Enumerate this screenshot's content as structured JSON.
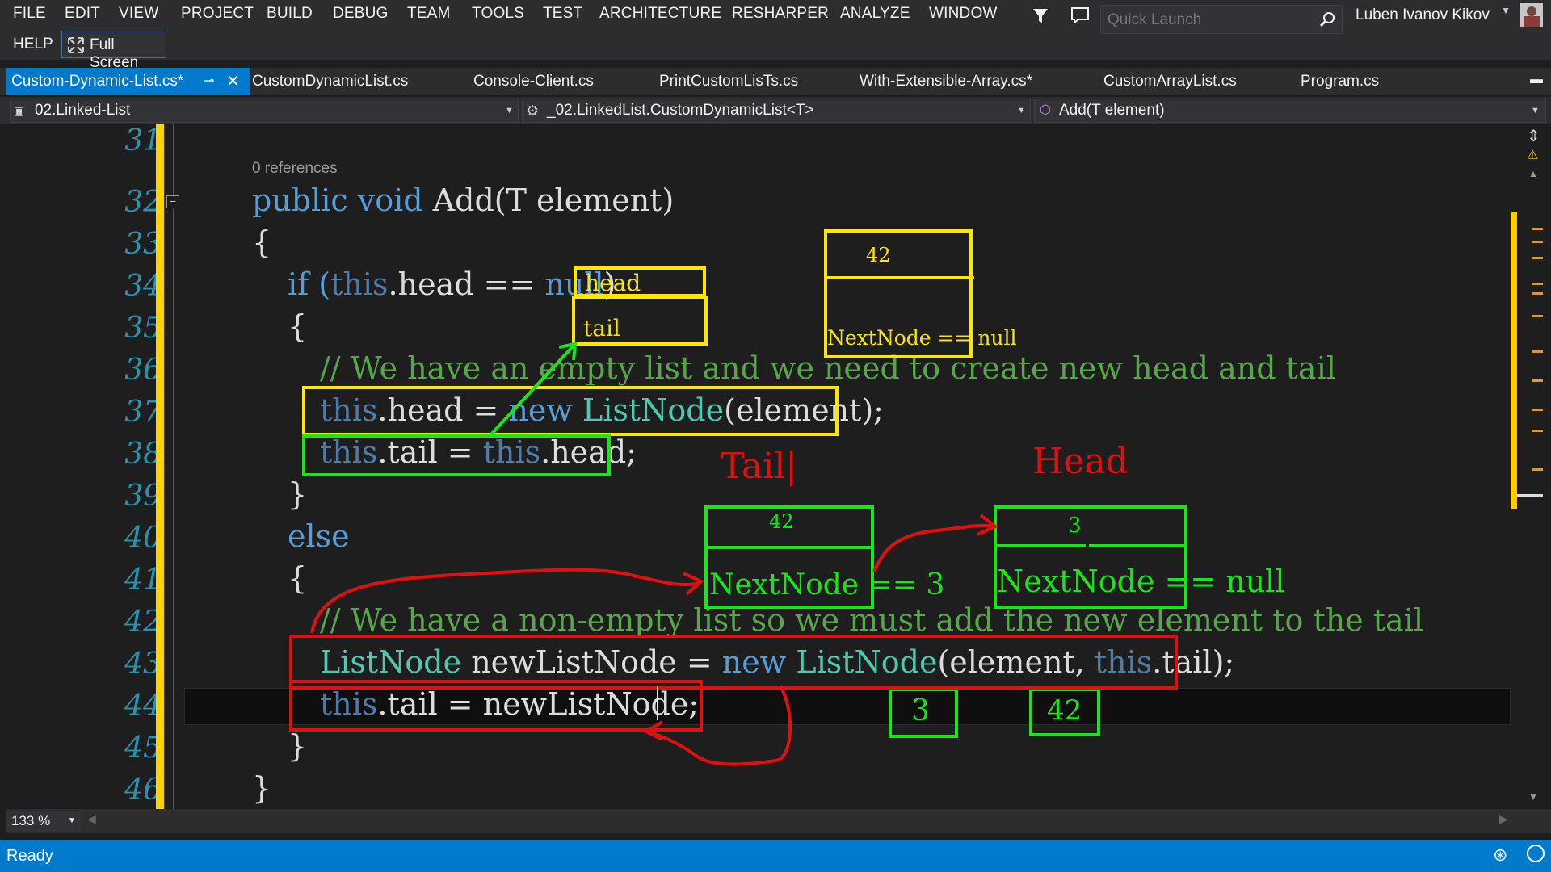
{
  "menu": {
    "items": [
      "FILE",
      "EDIT",
      "VIEW",
      "PROJECT",
      "BUILD",
      "DEBUG",
      "TEAM",
      "TOOLS",
      "TEST",
      "ARCHITECTURE",
      "RESHARPER",
      "ANALYZE",
      "WINDOW"
    ],
    "help": "HELP",
    "full_screen": "Full Screen",
    "quick_launch_placeholder": "Quick Launch",
    "user": "Luben Ivanov Kikov"
  },
  "tabs": [
    "Custom-Dynamic-List.cs*",
    "CustomDynamicList.cs",
    "Console-Client.cs",
    "PrintCustomLisTs.cs",
    "With-Extensible-Array.cs*",
    "CustomArrayList.cs",
    "Program.cs"
  ],
  "nav": {
    "project": "02.Linked-List",
    "class": "_02.LinkedList.CustomDynamicList<T>",
    "member": "Add(T element)"
  },
  "editor": {
    "line_numbers": [
      "31",
      "32",
      "33",
      "34",
      "35",
      "36",
      "37",
      "38",
      "39",
      "40",
      "41",
      "42",
      "43",
      "44",
      "45",
      "46"
    ],
    "codelens": "0 references",
    "lines": {
      "l32_kw": "public void ",
      "l32_rest": "Add(T element)",
      "l33": "{",
      "l34_if": "if (",
      "l34_this": "this",
      "l34_mid": ".head == ",
      "l34_null": "null",
      "l34_end": ")",
      "l35": "{",
      "l36": "// We have an empty list and we need to create new head and tail",
      "l37_this": "this",
      "l37_a": ".head = ",
      "l37_new": "new ",
      "l37_ty": "ListNode",
      "l37_end": "(element);",
      "l38_this": "this",
      "l38_a": ".tail = ",
      "l38_this2": "this",
      "l38_end": ".head;",
      "l39": "}",
      "l40": "else",
      "l41": "{",
      "l42": "// We have a non-empty list so we must add the new element to the tail",
      "l43_ty": "ListNode",
      "l43_a": " newListNode = ",
      "l43_new": "new ",
      "l43_ty2": "ListNode",
      "l43_b": "(element, ",
      "l43_this": "this",
      "l43_end": ".tail);",
      "l44_this": "this",
      "l44_end": ".tail = newListNode;",
      "l45": "}",
      "l46": "}"
    }
  },
  "annotations": {
    "yellow_head": "head",
    "yellow_tail": "tail",
    "yellow_node_value": "42",
    "yellow_node_next": "NextNode == null",
    "tail_label": "Tail|",
    "head_label": "Head",
    "green_node1_value": "42",
    "green_node1_next": "NextNode == 3",
    "green_node2_value": "3",
    "green_node2_next": "NextNode == null",
    "box_3": "3",
    "box_42": "42"
  },
  "zoom": "133 %",
  "status": "Ready",
  "colors": {
    "accent": "#007acc",
    "yellow_ink": "#ffe600",
    "green_ink": "#19e619",
    "red_ink": "#e01010"
  }
}
